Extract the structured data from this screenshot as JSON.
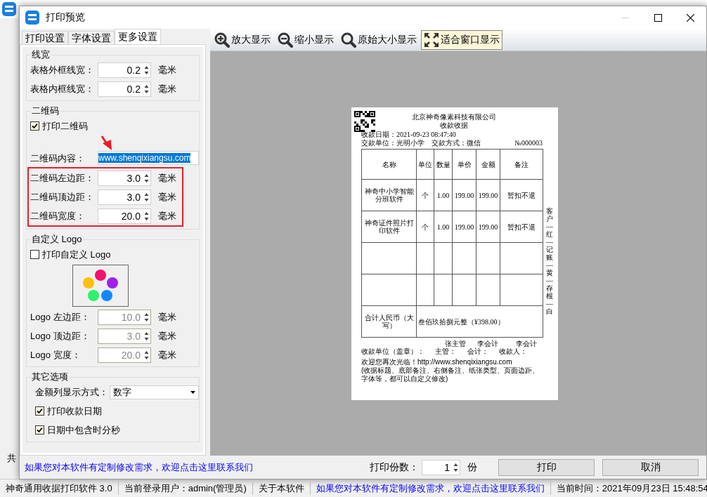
{
  "background_app": {
    "side_label": "共",
    "status_bar": [
      {
        "kind": "text",
        "text": "神奇通用收据打印软件 3.0"
      },
      {
        "kind": "text",
        "text": "当前登录用户：admin(管理员)"
      },
      {
        "kind": "text",
        "text": "关于本软件"
      },
      {
        "kind": "link",
        "text": "如果您对本软件有定制修改需求，欢迎点击这里联系我们"
      },
      {
        "kind": "clock",
        "text": "当前时间：2021年09月23日 15:48:54"
      }
    ]
  },
  "window": {
    "title": "打印预览"
  },
  "tabs": [
    {
      "label": "打印设置",
      "selected": false
    },
    {
      "label": "字体设置",
      "selected": false
    },
    {
      "label": "更多设置",
      "selected": true
    }
  ],
  "groups": [
    {
      "title": "线宽",
      "rows": [
        {
          "kind": "spin",
          "label": "表格外框线宽：",
          "value": "0.2",
          "unit": "毫米",
          "disabled": false,
          "highlighted": false
        },
        {
          "kind": "spin",
          "label": "表格内框线宽：",
          "value": "0.2",
          "unit": "毫米",
          "disabled": false,
          "highlighted": false
        }
      ]
    },
    {
      "title": "二维码",
      "rows": [
        {
          "kind": "checkbox",
          "label": "打印二维码",
          "checked": true
        },
        {
          "kind": "text",
          "label": "二维码内容：",
          "value": "www.shenqixiangsu.com",
          "selected": true,
          "pointed": true
        },
        {
          "kind": "spin",
          "label": "二维码左边距：",
          "value": "3.0",
          "unit": "毫米",
          "disabled": false,
          "highlighted": true
        },
        {
          "kind": "spin",
          "label": "二维码顶边距：",
          "value": "3.0",
          "unit": "毫米",
          "disabled": false,
          "highlighted": true
        },
        {
          "kind": "spin",
          "label": "二维码宽度：",
          "value": "20.0",
          "unit": "毫米",
          "disabled": false,
          "highlighted": true
        }
      ]
    },
    {
      "title": "自定义 Logo",
      "rows": [
        {
          "kind": "checkbox",
          "label": "打印自定义 Logo",
          "checked": false
        },
        {
          "kind": "logo"
        },
        {
          "kind": "spin",
          "label": "Logo 左边距：",
          "value": "10.0",
          "unit": "毫米",
          "disabled": true,
          "highlighted": false
        },
        {
          "kind": "spin",
          "label": "Logo 顶边距：",
          "value": "3.0",
          "unit": "毫米",
          "disabled": true,
          "highlighted": false
        },
        {
          "kind": "spin",
          "label": "Logo 宽度：",
          "value": "20.0",
          "unit": "毫米",
          "disabled": true,
          "highlighted": false
        }
      ]
    },
    {
      "title": "其它选项",
      "rows": [
        {
          "kind": "select",
          "label": "金额列显示方式：",
          "value": "数字"
        },
        {
          "kind": "checkbox",
          "label": "打印收款日期",
          "checked": true
        },
        {
          "kind": "checkbox",
          "label": "日期中包含时分秒",
          "checked": true
        }
      ]
    }
  ],
  "toolbar": [
    {
      "kind": "zoom-in",
      "label": "放大显示",
      "selected": false
    },
    {
      "kind": "zoom-out",
      "label": "缩小显示",
      "selected": false
    },
    {
      "kind": "actual-size",
      "label": "原始大小显示",
      "selected": false
    },
    {
      "kind": "fit",
      "label": "适合窗口显示",
      "selected": true
    }
  ],
  "document": {
    "title": "北京神奇像素科技有限公司",
    "subtitle": "收款收据",
    "meta": [
      "收款日期：2021-09-23 08:47:40",
      "交款单位：光明小学　交款方式：微信"
    ],
    "number": "№000003",
    "columns": [
      "名称",
      "单位",
      "数量",
      "单价",
      "金额",
      "备注"
    ],
    "rows": [
      {
        "kind": "item",
        "cells": [
          "神奇中小学智能分班软件",
          "个",
          "1.00",
          "199.00",
          "199.00",
          "暂扣不退"
        ]
      },
      {
        "kind": "item",
        "cells": [
          "神奇证件照片打印软件",
          "个",
          "1.00",
          "199.00",
          "199.00",
          "暂扣不退"
        ]
      },
      {
        "kind": "blank"
      },
      {
        "kind": "blank"
      }
    ],
    "total_label": "合计人民币（大写）",
    "total_value": "叁佰玖拾捌元整（¥398.00）",
    "side_note": "客户—红—记账—黄—存根—白",
    "signatures": [
      {
        "label": "收款单位（盖章）："
      },
      {
        "label": "主管：",
        "name": "张主管"
      },
      {
        "label": "会计：",
        "name": "李会计"
      },
      {
        "label": "收款人：",
        "name": "李会计"
      }
    ],
    "footer_lines": [
      "欢迎您再次光临！http://www.shenqixiangsu.com",
      "(收据标题、底部备注、右侧备注、纸张类型、页面边距、字体等，都可以自定义修改)"
    ]
  },
  "footer": {
    "link": "如果您对本软件有定制修改需求，欢迎点击这里联系我们",
    "copies_label": "打印份数：",
    "copies": "1",
    "copies_unit": "份",
    "buttons": [
      "打印",
      "取消"
    ]
  }
}
